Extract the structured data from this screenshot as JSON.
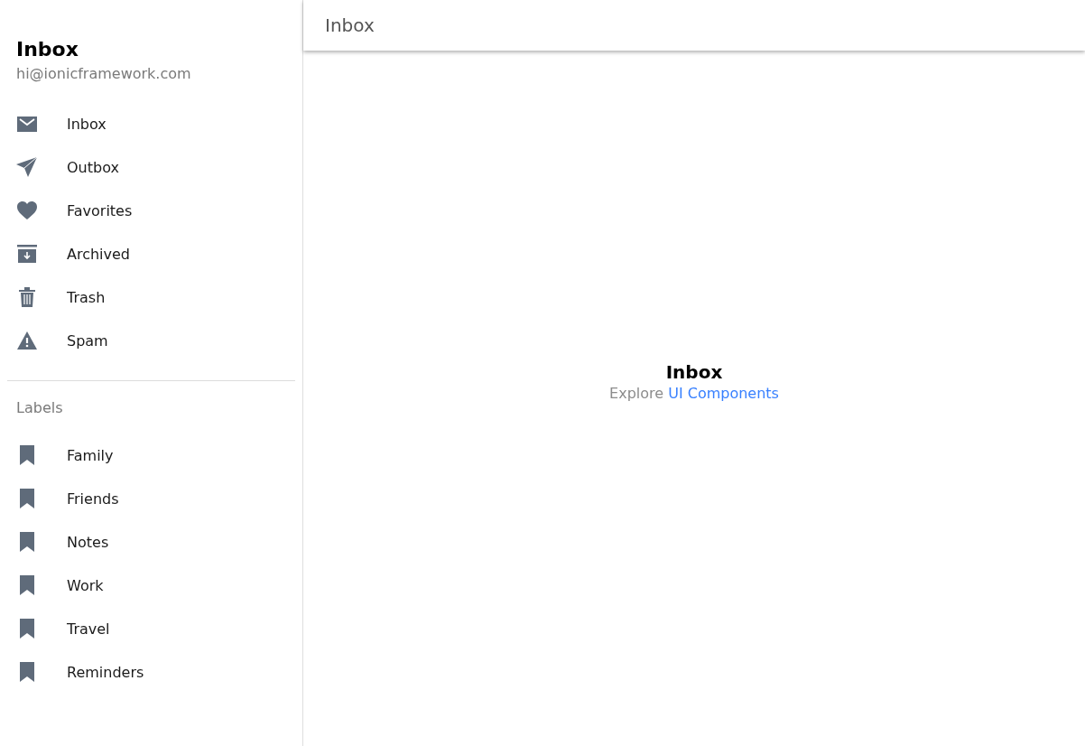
{
  "menu": {
    "title": "Inbox",
    "email": "hi@ionicframework.com",
    "items": [
      {
        "label": "Inbox"
      },
      {
        "label": "Outbox"
      },
      {
        "label": "Favorites"
      },
      {
        "label": "Archived"
      },
      {
        "label": "Trash"
      },
      {
        "label": "Spam"
      }
    ],
    "labels_heading": "Labels",
    "labels": [
      {
        "label": "Family"
      },
      {
        "label": "Friends"
      },
      {
        "label": "Notes"
      },
      {
        "label": "Work"
      },
      {
        "label": "Travel"
      },
      {
        "label": "Reminders"
      }
    ]
  },
  "toolbar": {
    "title": "Inbox"
  },
  "content": {
    "title": "Inbox",
    "text": "Explore",
    "link": "UI Components"
  }
}
